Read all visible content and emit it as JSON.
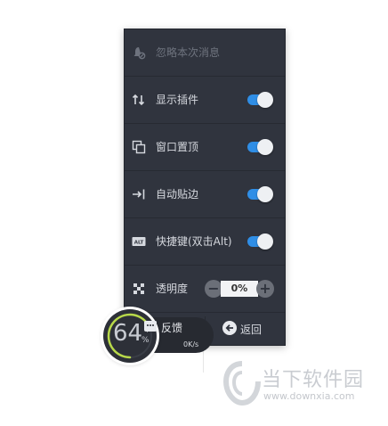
{
  "menu": {
    "ignore_message": "忽略本次消息",
    "items": [
      {
        "label": "显示插件",
        "toggle_on": true
      },
      {
        "label": "窗口置顶",
        "toggle_on": true
      },
      {
        "label": "自动贴边",
        "toggle_on": true
      },
      {
        "label": "快捷键(双击Alt)",
        "toggle_on": true
      }
    ],
    "opacity": {
      "label": "透明度",
      "value": "0%",
      "minus": "−",
      "plus": "+"
    },
    "back_label": "返回",
    "alt_icon_text": "ALT"
  },
  "floating_ball": {
    "value": "64",
    "unit": "%",
    "speed_text": "0K/s",
    "feedback_label": "反馈"
  },
  "watermark": {
    "logo_text": "当下软件园",
    "url": "www.downxia.com"
  },
  "colors": {
    "panel_bg": "#30343e",
    "toggle_on": "#2f8ee6",
    "text": "#d6d9df",
    "ring": "#b8d94a"
  }
}
